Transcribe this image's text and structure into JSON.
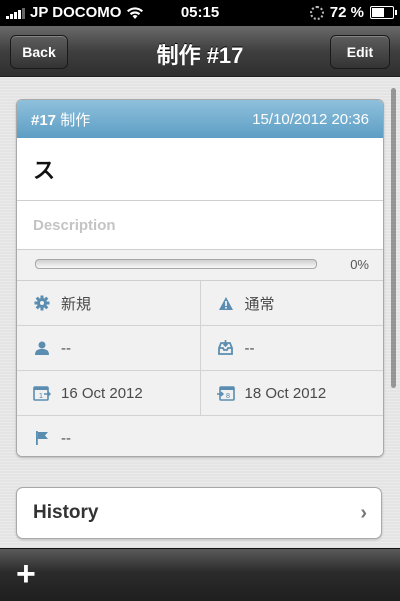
{
  "status_bar": {
    "carrier": "JP DOCOMO",
    "time": "05:15",
    "battery": "72 %",
    "battery_level": 0.72
  },
  "nav": {
    "back_label": "Back",
    "title": "制作 #17",
    "edit_label": "Edit"
  },
  "card": {
    "header_id": "#17",
    "header_type": "制作",
    "header_datetime": "15/10/2012 20:36",
    "title": "ス",
    "description_placeholder": "Description",
    "progress": 0,
    "progress_label": "0%",
    "status": "新規",
    "priority": "通常",
    "assignee": "--",
    "category": "--",
    "start_date": "16 Oct 2012",
    "due_date": "18 Oct 2012",
    "version": "--"
  },
  "history": {
    "label": "History"
  },
  "toolbar": {
    "add_label": "+"
  },
  "colors": {
    "header_blue": "#5d9ec4",
    "icon_blue": "#5b8db0",
    "nav_dark": "#3f3f3f"
  }
}
